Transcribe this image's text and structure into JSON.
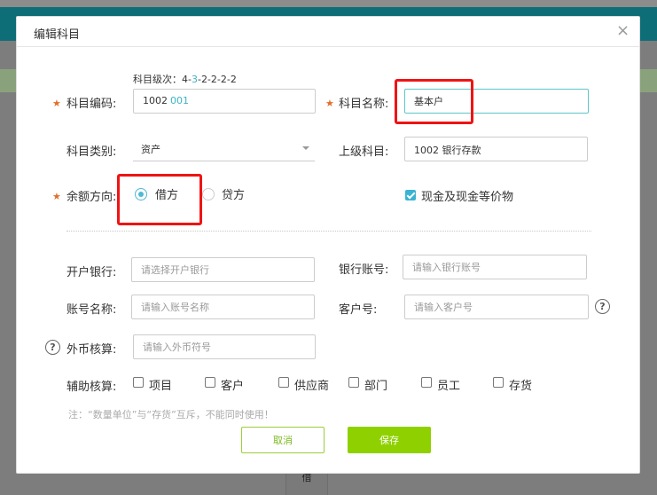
{
  "background": {
    "grid_cell_text": "借"
  },
  "dialog": {
    "title": "编辑科目",
    "close_glyph": "×",
    "level_hint_prefix": "科目级次：",
    "level_hint_first": "4-",
    "level_hint_highlight": "3",
    "level_hint_rest": "-2-2-2-2",
    "code_label": "科目编码:",
    "code_main": "1002",
    "code_sub": "001",
    "name_label": "科目名称:",
    "name_value": "基本户",
    "category_label": "科目类别:",
    "category_value": "资产",
    "parent_label": "上级科目:",
    "parent_value": "1002 银行存款",
    "balance_label": "余额方向:",
    "balance_debit": "借方",
    "balance_credit": "贷方",
    "cash_equiv_label": "现金及现金等价物",
    "bank_label": "开户银行:",
    "bank_placeholder": "请选择开户银行",
    "account_no_label": "银行账号:",
    "account_no_placeholder": "请输入银行账号",
    "account_name_label": "账号名称:",
    "account_name_placeholder": "请输入账号名称",
    "customer_no_label": "客户号:",
    "customer_no_placeholder": "请输入客户号",
    "currency_label": "外币核算:",
    "currency_placeholder": "请输入外币符号",
    "aux_label": "辅助核算:",
    "aux_options": [
      "项目",
      "客户",
      "供应商",
      "部门",
      "员工",
      "存货"
    ],
    "note": "注：“数量单位”与“存货”互斥，不能同时使用！",
    "cancel_label": "取消",
    "save_label": "保存"
  },
  "colors": {
    "accent_teal": "#3bb3c3",
    "save_green": "#8fd100",
    "required_star": "#e06f2a",
    "highlight_red": "#f01313"
  }
}
